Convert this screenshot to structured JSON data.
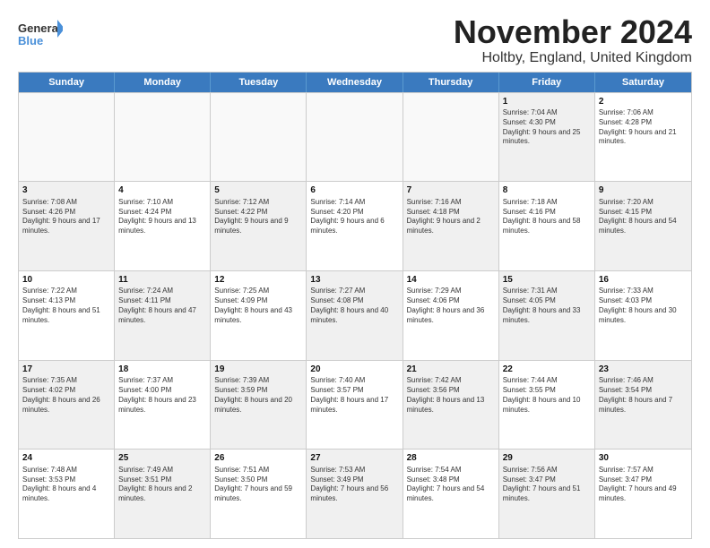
{
  "header": {
    "logo_line1": "General",
    "logo_line2": "Blue",
    "month": "November 2024",
    "location": "Holtby, England, United Kingdom"
  },
  "days_of_week": [
    "Sunday",
    "Monday",
    "Tuesday",
    "Wednesday",
    "Thursday",
    "Friday",
    "Saturday"
  ],
  "weeks": [
    [
      {
        "day": "",
        "text": "",
        "empty": true
      },
      {
        "day": "",
        "text": "",
        "empty": true
      },
      {
        "day": "",
        "text": "",
        "empty": true
      },
      {
        "day": "",
        "text": "",
        "empty": true
      },
      {
        "day": "",
        "text": "",
        "empty": true
      },
      {
        "day": "1",
        "text": "Sunrise: 7:04 AM\nSunset: 4:30 PM\nDaylight: 9 hours and 25 minutes.",
        "shaded": true
      },
      {
        "day": "2",
        "text": "Sunrise: 7:06 AM\nSunset: 4:28 PM\nDaylight: 9 hours and 21 minutes.",
        "shaded": false
      }
    ],
    [
      {
        "day": "3",
        "text": "Sunrise: 7:08 AM\nSunset: 4:26 PM\nDaylight: 9 hours and 17 minutes.",
        "shaded": true
      },
      {
        "day": "4",
        "text": "Sunrise: 7:10 AM\nSunset: 4:24 PM\nDaylight: 9 hours and 13 minutes.",
        "shaded": false
      },
      {
        "day": "5",
        "text": "Sunrise: 7:12 AM\nSunset: 4:22 PM\nDaylight: 9 hours and 9 minutes.",
        "shaded": true
      },
      {
        "day": "6",
        "text": "Sunrise: 7:14 AM\nSunset: 4:20 PM\nDaylight: 9 hours and 6 minutes.",
        "shaded": false
      },
      {
        "day": "7",
        "text": "Sunrise: 7:16 AM\nSunset: 4:18 PM\nDaylight: 9 hours and 2 minutes.",
        "shaded": true
      },
      {
        "day": "8",
        "text": "Sunrise: 7:18 AM\nSunset: 4:16 PM\nDaylight: 8 hours and 58 minutes.",
        "shaded": false
      },
      {
        "day": "9",
        "text": "Sunrise: 7:20 AM\nSunset: 4:15 PM\nDaylight: 8 hours and 54 minutes.",
        "shaded": true
      }
    ],
    [
      {
        "day": "10",
        "text": "Sunrise: 7:22 AM\nSunset: 4:13 PM\nDaylight: 8 hours and 51 minutes.",
        "shaded": false
      },
      {
        "day": "11",
        "text": "Sunrise: 7:24 AM\nSunset: 4:11 PM\nDaylight: 8 hours and 47 minutes.",
        "shaded": true
      },
      {
        "day": "12",
        "text": "Sunrise: 7:25 AM\nSunset: 4:09 PM\nDaylight: 8 hours and 43 minutes.",
        "shaded": false
      },
      {
        "day": "13",
        "text": "Sunrise: 7:27 AM\nSunset: 4:08 PM\nDaylight: 8 hours and 40 minutes.",
        "shaded": true
      },
      {
        "day": "14",
        "text": "Sunrise: 7:29 AM\nSunset: 4:06 PM\nDaylight: 8 hours and 36 minutes.",
        "shaded": false
      },
      {
        "day": "15",
        "text": "Sunrise: 7:31 AM\nSunset: 4:05 PM\nDaylight: 8 hours and 33 minutes.",
        "shaded": true
      },
      {
        "day": "16",
        "text": "Sunrise: 7:33 AM\nSunset: 4:03 PM\nDaylight: 8 hours and 30 minutes.",
        "shaded": false
      }
    ],
    [
      {
        "day": "17",
        "text": "Sunrise: 7:35 AM\nSunset: 4:02 PM\nDaylight: 8 hours and 26 minutes.",
        "shaded": true
      },
      {
        "day": "18",
        "text": "Sunrise: 7:37 AM\nSunset: 4:00 PM\nDaylight: 8 hours and 23 minutes.",
        "shaded": false
      },
      {
        "day": "19",
        "text": "Sunrise: 7:39 AM\nSunset: 3:59 PM\nDaylight: 8 hours and 20 minutes.",
        "shaded": true
      },
      {
        "day": "20",
        "text": "Sunrise: 7:40 AM\nSunset: 3:57 PM\nDaylight: 8 hours and 17 minutes.",
        "shaded": false
      },
      {
        "day": "21",
        "text": "Sunrise: 7:42 AM\nSunset: 3:56 PM\nDaylight: 8 hours and 13 minutes.",
        "shaded": true
      },
      {
        "day": "22",
        "text": "Sunrise: 7:44 AM\nSunset: 3:55 PM\nDaylight: 8 hours and 10 minutes.",
        "shaded": false
      },
      {
        "day": "23",
        "text": "Sunrise: 7:46 AM\nSunset: 3:54 PM\nDaylight: 8 hours and 7 minutes.",
        "shaded": true
      }
    ],
    [
      {
        "day": "24",
        "text": "Sunrise: 7:48 AM\nSunset: 3:53 PM\nDaylight: 8 hours and 4 minutes.",
        "shaded": false
      },
      {
        "day": "25",
        "text": "Sunrise: 7:49 AM\nSunset: 3:51 PM\nDaylight: 8 hours and 2 minutes.",
        "shaded": true
      },
      {
        "day": "26",
        "text": "Sunrise: 7:51 AM\nSunset: 3:50 PM\nDaylight: 7 hours and 59 minutes.",
        "shaded": false
      },
      {
        "day": "27",
        "text": "Sunrise: 7:53 AM\nSunset: 3:49 PM\nDaylight: 7 hours and 56 minutes.",
        "shaded": true
      },
      {
        "day": "28",
        "text": "Sunrise: 7:54 AM\nSunset: 3:48 PM\nDaylight: 7 hours and 54 minutes.",
        "shaded": false
      },
      {
        "day": "29",
        "text": "Sunrise: 7:56 AM\nSunset: 3:47 PM\nDaylight: 7 hours and 51 minutes.",
        "shaded": true
      },
      {
        "day": "30",
        "text": "Sunrise: 7:57 AM\nSunset: 3:47 PM\nDaylight: 7 hours and 49 minutes.",
        "shaded": false
      }
    ]
  ]
}
